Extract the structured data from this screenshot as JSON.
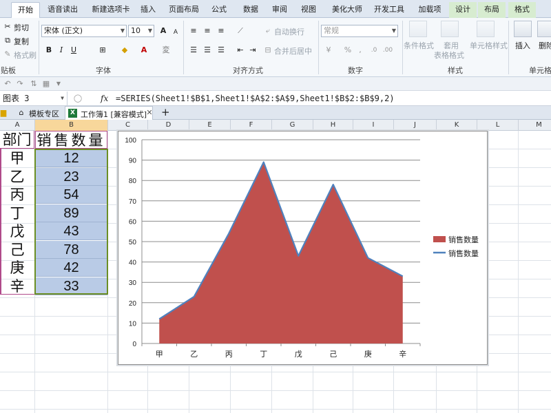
{
  "tabs": [
    "开始",
    "语音读出",
    "新建选项卡",
    "插入",
    "页面布局",
    "公式",
    "数据",
    "审阅",
    "视图",
    "美化大师",
    "开发工具",
    "加载项",
    "设计",
    "布局",
    "格式"
  ],
  "ribbon": {
    "clipboard": {
      "cut": "剪切",
      "copy": "复制",
      "format_painter": "格式刷",
      "label": "贴板"
    },
    "font": {
      "name": "宋体 (正文)",
      "size": "10",
      "label": "字体"
    },
    "align": {
      "wrap": "自动换行",
      "merge": "合并后居中",
      "label": "对齐方式"
    },
    "number": {
      "format": "常规",
      "label": "数字"
    },
    "styles": {
      "cond": "条件格式",
      "table1": "套用",
      "table2": "表格格式",
      "cell": "单元格样式",
      "label": "样式"
    },
    "cells": {
      "insert": "插入",
      "delete": "删除",
      "label": "单元格"
    }
  },
  "formula_bar": {
    "name_box": "图表 3",
    "fx": "fx",
    "formula": "=SERIES(Sheet1!$B$1,Sheet1!$A$2:$A$9,Sheet1!$B$2:$B$9,2)"
  },
  "doc_tabs": {
    "template": "模板专区",
    "workbook": "工作簿1 [兼容模式]",
    "add": "+"
  },
  "columns": [
    "A",
    "B",
    "C",
    "D",
    "E",
    "F",
    "G",
    "H",
    "I",
    "J",
    "K",
    "L",
    "M"
  ],
  "sheet": {
    "header_a": "部门",
    "header_b": "销售数量",
    "rows": [
      {
        "dept": "甲",
        "qty": "12"
      },
      {
        "dept": "乙",
        "qty": "23"
      },
      {
        "dept": "丙",
        "qty": "54"
      },
      {
        "dept": "丁",
        "qty": "89"
      },
      {
        "dept": "戊",
        "qty": "43"
      },
      {
        "dept": "己",
        "qty": "78"
      },
      {
        "dept": "庚",
        "qty": "42"
      },
      {
        "dept": "辛",
        "qty": "33"
      }
    ]
  },
  "chart_data": {
    "type": "area",
    "categories": [
      "甲",
      "乙",
      "丙",
      "丁",
      "戊",
      "己",
      "庚",
      "辛"
    ],
    "series": [
      {
        "name": "销售数量",
        "values": [
          12,
          23,
          54,
          89,
          43,
          78,
          42,
          33
        ],
        "color": "#c0504d",
        "kind": "area"
      },
      {
        "name": "销售数量",
        "values": [
          12,
          23,
          54,
          89,
          43,
          78,
          42,
          33
        ],
        "color": "#4f81bd",
        "kind": "line"
      }
    ],
    "ylim": [
      0,
      100
    ],
    "yticks": [
      "0",
      "10",
      "20",
      "30",
      "40",
      "50",
      "60",
      "70",
      "80",
      "90",
      "100"
    ],
    "grid": true,
    "legend": "right"
  }
}
